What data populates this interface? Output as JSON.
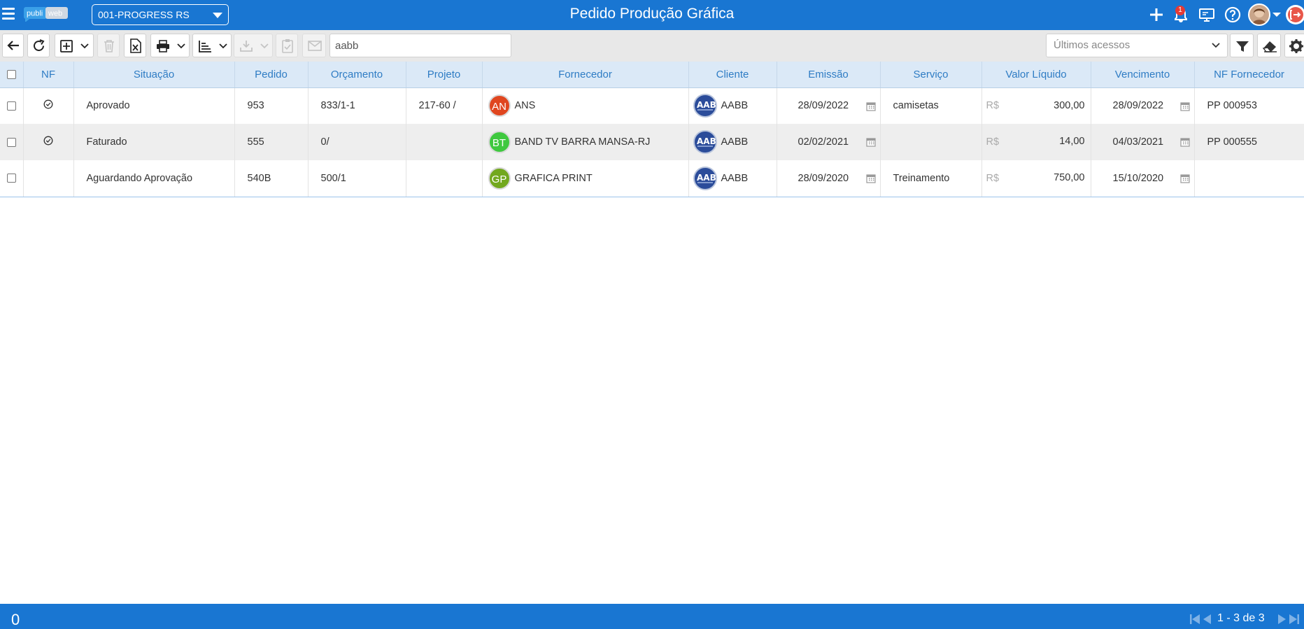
{
  "header": {
    "title": "Pedido Produção Gráfica",
    "logo_text_left": "publi",
    "logo_text_right": "web",
    "company": "001-PROGRESS RS",
    "notification_count": "1"
  },
  "toolbar": {
    "search_value": "aabb",
    "recent_placeholder": "Últimos acessos"
  },
  "table": {
    "columns": [
      "NF",
      "Situação",
      "Pedido",
      "Orçamento",
      "Projeto",
      "Fornecedor",
      "Cliente",
      "Emissão",
      "Serviço",
      "Valor Líquido",
      "Vencimento",
      "NF Fornecedor"
    ],
    "currency_prefix": "R$",
    "rows": [
      {
        "nf_checked": true,
        "situacao": "Aprovado",
        "pedido": "953",
        "orcamento": "833/1-1",
        "projeto": "217-60 /",
        "fornecedor_initials": "AN",
        "fornecedor_color": "#e0461f",
        "fornecedor": "ANS",
        "cliente": "AABB",
        "emissao": "28/09/2022",
        "servico": "camisetas",
        "valor": "300,00",
        "vencimento": "28/09/2022",
        "nf_fornecedor": "PP 000953"
      },
      {
        "nf_checked": true,
        "situacao": "Faturado",
        "pedido": "555",
        "orcamento": "0/",
        "projeto": "",
        "fornecedor_initials": "BT",
        "fornecedor_color": "#3fc83f",
        "fornecedor": "BAND TV BARRA MANSA-RJ",
        "cliente": "AABB",
        "emissao": "02/02/2021",
        "servico": "",
        "valor": "14,00",
        "vencimento": "04/03/2021",
        "nf_fornecedor": "PP 000555"
      },
      {
        "nf_checked": false,
        "situacao": "Aguardando Aprovação",
        "pedido": "540B",
        "orcamento": "500/1",
        "projeto": "",
        "fornecedor_initials": "GP",
        "fornecedor_color": "#72a81e",
        "fornecedor": "GRAFICA PRINT",
        "cliente": "AABB",
        "emissao": "28/09/2020",
        "servico": "Treinamento",
        "valor": "750,00",
        "vencimento": "15/10/2020",
        "nf_fornecedor": ""
      }
    ]
  },
  "footer": {
    "selected_count": "0",
    "pager": "1 - 3 de 3"
  },
  "colors": {
    "primary": "#1976d2",
    "header_bg": "#dbe9f7",
    "header_text": "#2e7cc4"
  },
  "icons": [
    "hamburger-icon",
    "plus-icon",
    "bell-icon",
    "monitor-icon",
    "help-icon",
    "logout-icon",
    "back-arrow-icon",
    "refresh-icon",
    "add-icon",
    "trash-icon",
    "excel-icon",
    "print-icon",
    "sort-icon",
    "download-icon",
    "clipboard-icon",
    "mail-icon",
    "filter-icon",
    "eraser-icon",
    "gear-icon",
    "calendar-icon",
    "check-circle-icon"
  ]
}
